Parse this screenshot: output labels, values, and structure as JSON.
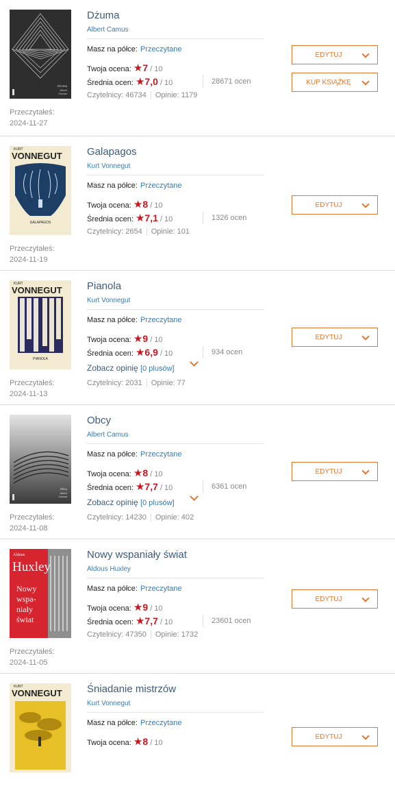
{
  "labels": {
    "shelf": "Masz na półce:",
    "your_rating": "Twoja ocena:",
    "avg_rating": "Średnia ocen:",
    "read_on": "Przeczytałeś:",
    "readers": "Czytelnicy:",
    "opinions": "Opinie:",
    "edit": "EDYTUJ",
    "buy": "KUP KSIĄŻKĘ",
    "see_opinion": "Zobacz opinię",
    "pluses": "[0 plusów]",
    "out_of": "/ 10",
    "ratings_suffix": "ocen"
  },
  "colors": {
    "accent": "#e8752e",
    "rating": "#c8171e",
    "title": "#3d5b7a",
    "link": "#3d7ab0"
  },
  "books": [
    {
      "title": "Dżuma",
      "author": "Albert Camus",
      "shelf": "Przeczytane",
      "your_rating": "7",
      "avg_rating": "7,0",
      "ratings_count": "28671",
      "readers": "46734",
      "opinions": "1179",
      "read_date": "2024-11-27",
      "cover_text": [
        "Dżuma",
        "Albert",
        "Camus"
      ],
      "has_buy": true
    },
    {
      "title": "Galapagos",
      "author": "Kurt Vonnegut",
      "shelf": "Przeczytane",
      "your_rating": "8",
      "avg_rating": "7,1",
      "ratings_count": "1326",
      "readers": "2654",
      "opinions": "101",
      "read_date": "2024-11-19",
      "cover_text": [
        "KURT",
        "VONNEGUT",
        "GALAPAGOS"
      ]
    },
    {
      "title": "Pianola",
      "author": "Kurt Vonnegut",
      "shelf": "Przeczytane",
      "your_rating": "9",
      "avg_rating": "6,9",
      "ratings_count": "934",
      "readers": "2031",
      "opinions": "77",
      "read_date": "2024-11-13",
      "cover_text": [
        "KURT",
        "VONNEGUT",
        "PIANOLA"
      ],
      "has_opinion": true
    },
    {
      "title": "Obcy",
      "author": "Albert Camus",
      "shelf": "Przeczytane",
      "your_rating": "8",
      "avg_rating": "7,7",
      "ratings_count": "6361",
      "readers": "14230",
      "opinions": "402",
      "read_date": "2024-11-08",
      "cover_text": [
        "Obcy",
        "Albert",
        "Camus"
      ],
      "has_opinion": true
    },
    {
      "title": "Nowy wspaniały świat",
      "author": "Aldous Huxley",
      "shelf": "Przeczytane",
      "your_rating": "9",
      "avg_rating": "7,7",
      "ratings_count": "23601",
      "readers": "47350",
      "opinions": "1732",
      "read_date": "2024-11-05",
      "cover_text": [
        "Aldous",
        "Huxley",
        "Nowy",
        "wspa-",
        "niały",
        "świat"
      ]
    },
    {
      "title": "Śniadanie mistrzów",
      "author": "Kurt Vonnegut",
      "shelf": "Przeczytane",
      "your_rating": "8",
      "cover_text": [
        "KURT",
        "VONNEGUT"
      ]
    }
  ]
}
